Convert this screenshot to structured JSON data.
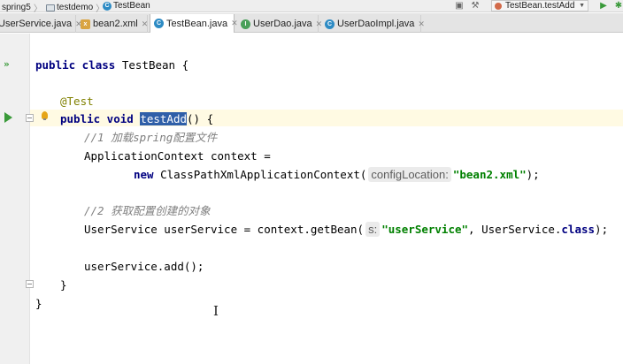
{
  "breadcrumb": {
    "project": "spring5",
    "module": "testdemo",
    "class": "TestBean"
  },
  "toolbar": {
    "run_config": "TestBean.testAdd"
  },
  "tabs": [
    {
      "label": "UserService.java",
      "icon": "interface-icon",
      "active": false
    },
    {
      "label": "bean2.xml",
      "icon": "xml-file-icon",
      "active": false
    },
    {
      "label": "TestBean.java",
      "icon": "class-icon",
      "active": true
    },
    {
      "label": "UserDao.java",
      "icon": "interface-icon",
      "active": false
    },
    {
      "label": "UserDaoImpl.java",
      "icon": "class-icon",
      "active": false
    }
  ],
  "code": {
    "class_kw": "public class",
    "class_name": " TestBean {",
    "annotation": "@Test",
    "method_kw": "public void",
    "method_name": "testAdd",
    "method_tail": "() {",
    "comment1": "//1 加载spring配置文件",
    "ctx_decl": "ApplicationContext context =",
    "new_kw": "new",
    "ctor": " ClassPathXmlApplicationContext(",
    "hint1": "configLocation:",
    "str1": "\"bean2.xml\"",
    "ctor_end": ");",
    "comment2": "//2 获取配置创建的对象",
    "getbean_pre": "UserService userService = context.getBean(",
    "hint2": "s:",
    "str2": "\"userService\"",
    "getbean_mid": ", UserService.",
    "class_kw2": "class",
    "getbean_end": ");",
    "add_call": "userService.add();",
    "close_method": "}",
    "close_class": "}"
  }
}
